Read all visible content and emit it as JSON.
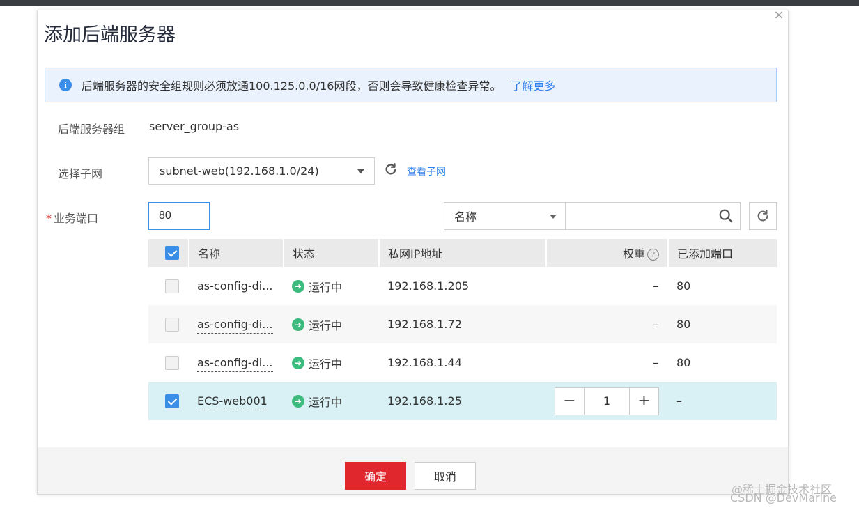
{
  "dialog": {
    "title": "添加后端服务器",
    "close_symbol": "×",
    "notice_text": "后端服务器的安全组规则必须放通100.125.0.0/16网段，否则会导致健康检查异常。",
    "notice_link": "了解更多",
    "info_glyph": "i"
  },
  "form": {
    "group_label": "后端服务器组",
    "group_value": "server_group-as",
    "subnet_label": "选择子网",
    "subnet_value": "subnet-web(192.168.1.0/24)",
    "view_subnet": "查看子网",
    "port_required_mark": "*",
    "port_label": "业务端口",
    "port_value": "80",
    "filter_field": "名称",
    "filter_placeholder": ""
  },
  "table": {
    "headers": {
      "name": "名称",
      "status": "状态",
      "ip": "私网IP地址",
      "weight": "权重",
      "port": "已添加端口",
      "help_glyph": "?"
    },
    "rows": [
      {
        "name": "as-config-di...",
        "status": "运行中",
        "ip": "192.168.1.205",
        "weight": "–",
        "port": "80",
        "checked": false
      },
      {
        "name": "as-config-di...",
        "status": "运行中",
        "ip": "192.168.1.72",
        "weight": "–",
        "port": "80",
        "checked": false
      },
      {
        "name": "as-config-di...",
        "status": "运行中",
        "ip": "192.168.1.44",
        "weight": "–",
        "port": "80",
        "checked": false
      },
      {
        "name": "ECS-web001",
        "status": "运行中",
        "ip": "192.168.1.25",
        "weight": "1",
        "port": "–",
        "checked": true
      }
    ],
    "stepper_minus": "−",
    "stepper_plus": "+"
  },
  "footer": {
    "ok_label": "确定",
    "cancel_label": "取消"
  },
  "watermark": {
    "line1": "@稀土掘金技术社区",
    "line2": "CSDN @DevMarine"
  },
  "colors": {
    "primary": "#e0272e",
    "link": "#2f80ed",
    "running": "#3dbb7e"
  }
}
